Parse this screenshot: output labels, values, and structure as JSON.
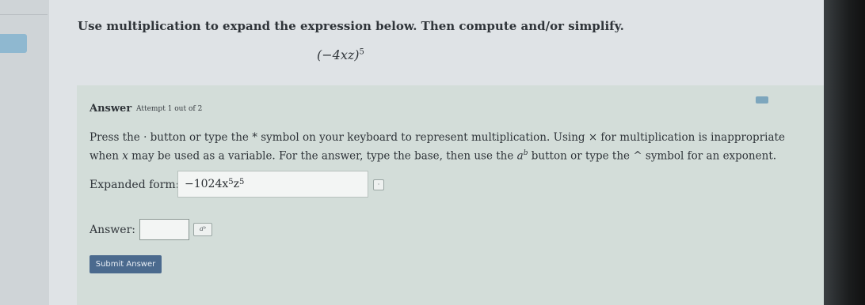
{
  "question": {
    "prompt": "Use multiplication to expand the expression below. Then compute and/or simplify.",
    "expression_base": "(−4xz)",
    "expression_exponent": "5"
  },
  "answer_section": {
    "heading": "Answer",
    "attempt": "Attempt 1 out of 2",
    "instructions_part1": "Press the · button or type the * symbol on your keyboard to represent multiplication. Using × for multiplication is inappropriate when ",
    "instructions_var": "x",
    "instructions_part2": " may be used as a variable. For the answer, type the base, then use the ",
    "instructions_ab_base": "a",
    "instructions_ab_exp": "b",
    "instructions_part3": " button or type the ^ symbol for an exponent.",
    "expanded_label": "Expanded form:",
    "expanded_value": {
      "coef": "−1024x",
      "exp1": "5",
      "var2": "z",
      "exp2": "5"
    },
    "expanded_button_glyph": "·",
    "answer_label": "Answer:",
    "answer_value": "",
    "exponent_button_glyph": "aᵇ",
    "submit_label": "Submit Answer"
  },
  "colors": {
    "submit_bg": "#4b6a8e",
    "panel_bg": "#d3ddd9",
    "page_bg": "#dfe3e6"
  }
}
